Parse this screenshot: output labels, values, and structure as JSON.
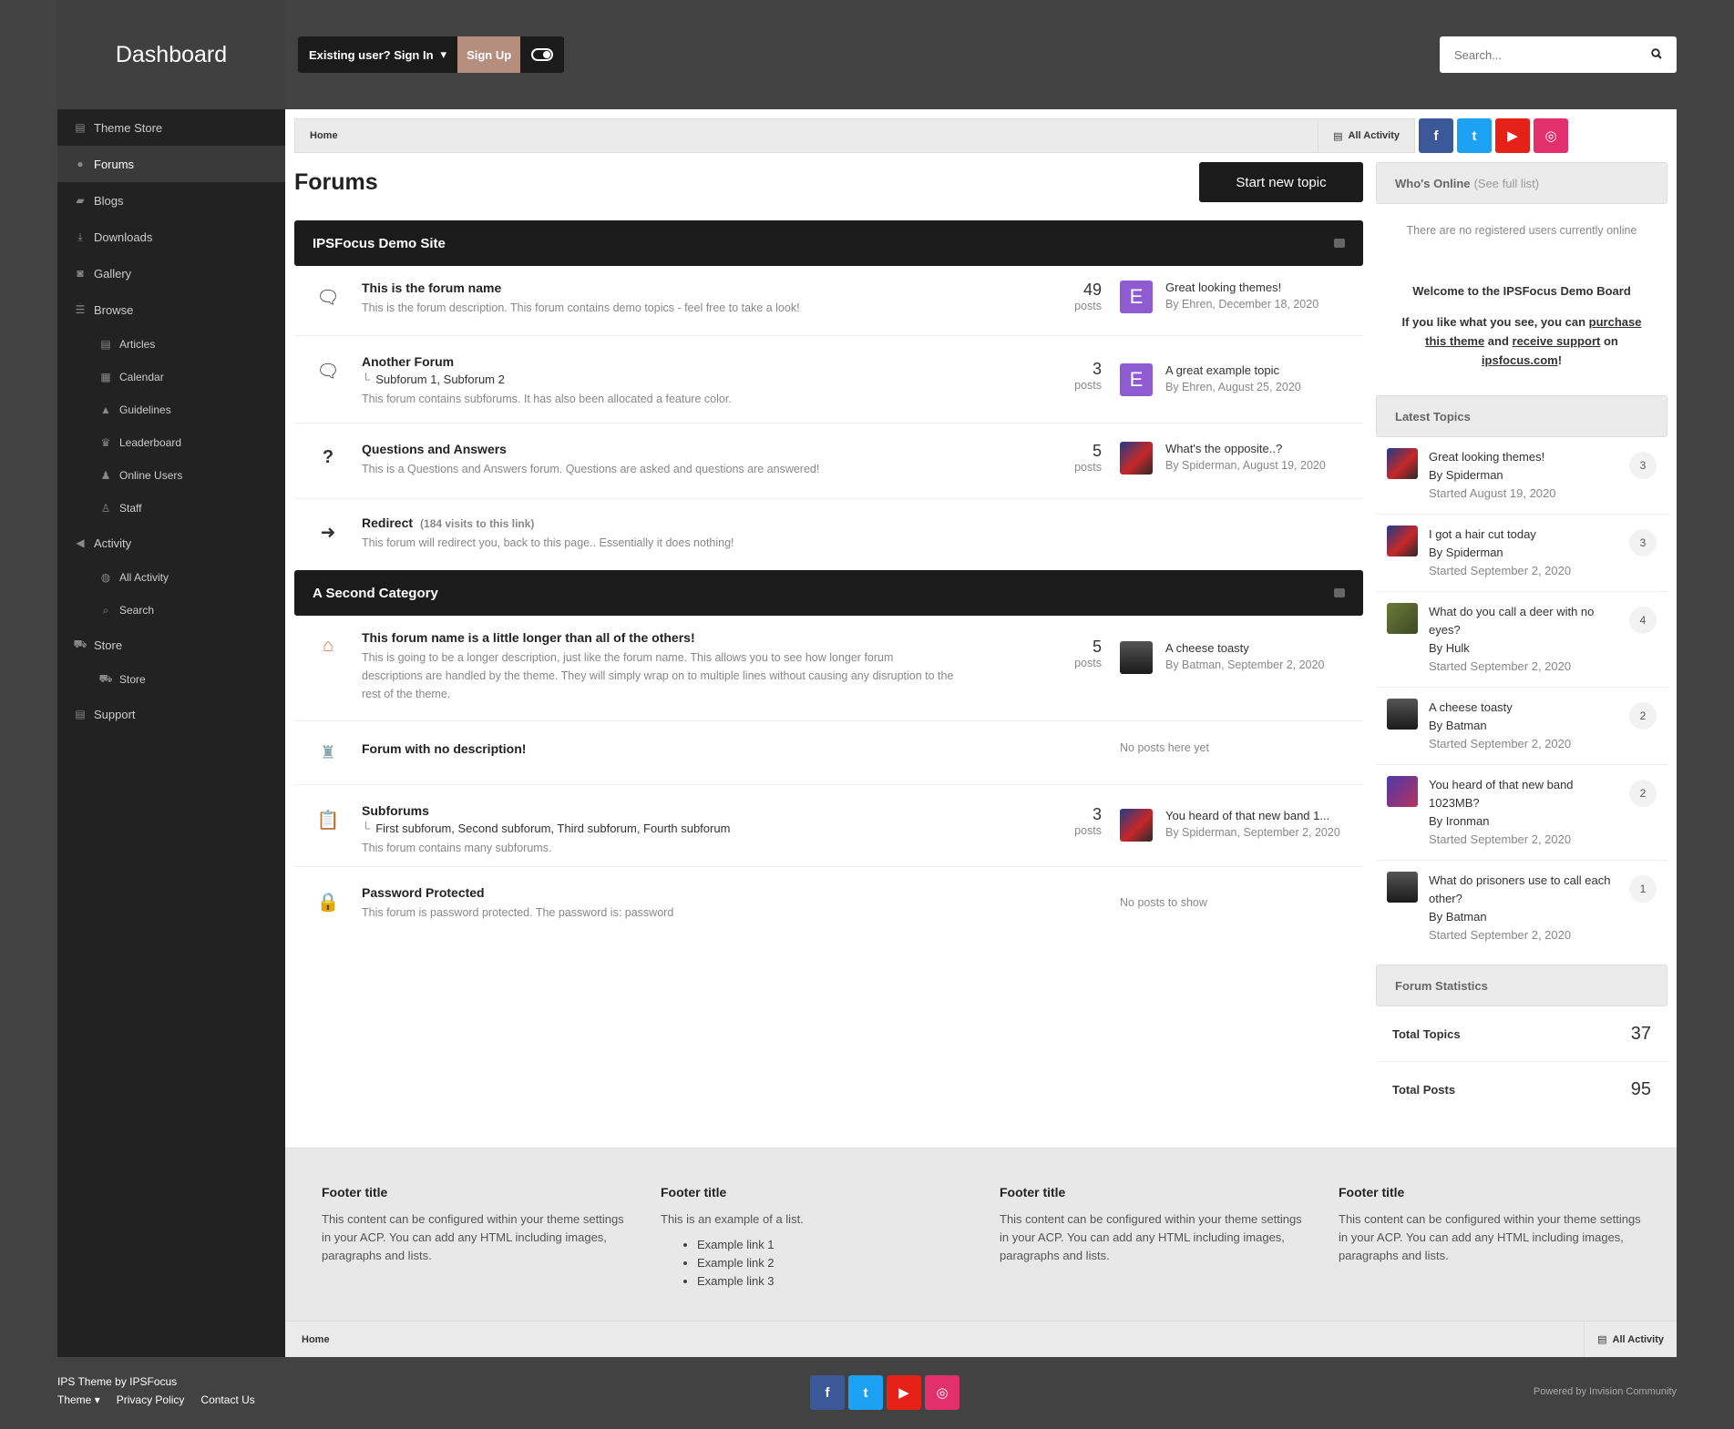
{
  "brand": "Dashboard",
  "userbar": {
    "signin": "Existing user? Sign In",
    "signup": "Sign Up"
  },
  "search": {
    "placeholder": "Search..."
  },
  "sidebar": {
    "items": [
      {
        "label": "Theme Store",
        "icon": "file-icon"
      },
      {
        "label": "Forums",
        "icon": "comments-icon",
        "active": true
      },
      {
        "label": "Blogs",
        "icon": "book-icon"
      },
      {
        "label": "Downloads",
        "icon": "download-icon"
      },
      {
        "label": "Gallery",
        "icon": "camera-icon"
      },
      {
        "label": "Browse",
        "icon": "list-icon"
      }
    ],
    "browse_sub": [
      "Articles",
      "Calendar",
      "Guidelines",
      "Leaderboard",
      "Online Users",
      "Staff"
    ],
    "activity": "Activity",
    "activity_sub": [
      "All Activity",
      "Search"
    ],
    "store": "Store",
    "store_sub": [
      "Store"
    ],
    "support": "Support"
  },
  "breadcrumb": {
    "home": "Home",
    "all_activity": "All Activity"
  },
  "social": {
    "fb": "f",
    "tw": "t",
    "yt": "▶",
    "ig": "◎",
    "colors": {
      "fb": "#3b5998",
      "tw": "#1da1f2",
      "yt": "#e62117",
      "ig": "#e1306c"
    }
  },
  "page": {
    "title": "Forums",
    "start_topic": "Start new topic"
  },
  "categories": [
    {
      "name": "IPSFocus Demo Site",
      "forums": [
        {
          "title": "This is the forum name",
          "desc": "This is the forum description. This forum contains demo topics - feel free to take a look!",
          "posts": "49",
          "posts_label": "posts",
          "last_title": "Great looking themes!",
          "last_by": "By Ehren, December 18, 2020",
          "icon": "comments-icon"
        },
        {
          "title": "Another Forum",
          "subforums": "Subforum 1,   Subforum 2",
          "desc": "This forum contains subforums. It has also been allocated a feature color.",
          "posts": "3",
          "posts_label": "posts",
          "last_title": "A great example topic",
          "last_by": "By Ehren, August 25, 2020",
          "icon": "comments-icon"
        },
        {
          "title": "Questions and Answers",
          "desc": "This is a Questions and Answers forum. Questions are asked and questions are answered!",
          "posts": "5",
          "posts_label": "posts",
          "last_title": "What's the opposite..?",
          "last_by": "By Spiderman, August 19, 2020",
          "icon": "question-icon"
        },
        {
          "title": "Redirect",
          "visits": "(184 visits to this link)",
          "desc": "This forum will redirect you, back to this page.. Essentially it does nothing!",
          "icon": "arrow-right-icon"
        }
      ]
    },
    {
      "name": "A Second Category",
      "forums": [
        {
          "title": "This forum name is a little longer than all of the others!",
          "desc": "This is going to be a longer description, just like the forum name. This allows you to see how longer forum descriptions are handled by the theme. They will simply wrap on to multiple lines without causing any disruption to the rest of the theme.",
          "posts": "5",
          "posts_label": "posts",
          "last_title": "A cheese toasty",
          "last_by": "By Batman, September 2, 2020",
          "icon": "house-icon"
        },
        {
          "title": "Forum with no description!",
          "nopost": "No posts here yet",
          "icon": "jacket-icon"
        },
        {
          "title": "Subforums",
          "subforums": "First subforum,   Second subforum,   Third subforum,   Fourth subforum",
          "desc": "This forum contains many subforums.",
          "posts": "3",
          "posts_label": "posts",
          "last_title": "You heard of that new band 1...",
          "last_by": "By Spiderman, September 2, 2020",
          "icon": "clipboard-icon"
        },
        {
          "title": "Password Protected",
          "desc": "This forum is password protected. The password is: password",
          "nopost": "No posts to show",
          "icon": "lock-icon"
        }
      ]
    }
  ],
  "online": {
    "title": "Who's Online",
    "link": "(See full list)",
    "text": "There are no registered users currently online"
  },
  "welcome": {
    "title": "Welcome to the IPSFocus Demo Board",
    "l1": "If you like what you see, you can ",
    "purchase": "purchase",
    "this_theme": "this theme",
    "and": " and ",
    "receive": "receive support",
    "on": " on",
    "site": "ipsfocus.com",
    "bang": "!"
  },
  "latest": {
    "title": "Latest Topics",
    "topics": [
      {
        "title": "Great looking themes!",
        "by": "By Spiderman",
        "started": "Started August 19, 2020",
        "count": "3"
      },
      {
        "title": "I got a hair cut today",
        "by": "By Spiderman",
        "started": "Started September 2, 2020",
        "count": "3"
      },
      {
        "title": "What do you call a deer with no eyes?",
        "by": "By Hulk",
        "started": "Started September 2, 2020",
        "count": "4"
      },
      {
        "title": "A cheese toasty",
        "by": "By Batman",
        "started": "Started September 2, 2020",
        "count": "2"
      },
      {
        "title": "You heard of that new band 1023MB?",
        "by": "By Ironman",
        "started": "Started September 2, 2020",
        "count": "2"
      },
      {
        "title": "What do prisoners use to call each other?",
        "by": "By Batman",
        "started": "Started September 2, 2020",
        "count": "1"
      }
    ]
  },
  "stats": {
    "title": "Forum Statistics",
    "topics_label": "Total Topics",
    "topics": "37",
    "posts_label": "Total Posts",
    "posts": "95"
  },
  "footer": {
    "cols": [
      {
        "title": "Footer title",
        "text": "This content can be configured within your theme settings in your ACP. You can add any HTML including images, paragraphs and lists."
      },
      {
        "title": "Footer title",
        "text": "This is an example of a list.",
        "links": [
          "Example link 1",
          "Example link 2",
          "Example link 3"
        ]
      },
      {
        "title": "Footer title",
        "text": "This content can be configured within your theme settings in your ACP. You can add any HTML including images, paragraphs and lists."
      },
      {
        "title": "Footer title",
        "text": "This content can be configured within your theme settings in your ACP. You can add any HTML including images, paragraphs and lists."
      }
    ]
  },
  "bottom": {
    "credit": "IPS Theme by IPSFocus",
    "theme": "Theme",
    "privacy": "Privacy Policy",
    "contact": "Contact Us",
    "powered": "Powered by Invision Community"
  }
}
